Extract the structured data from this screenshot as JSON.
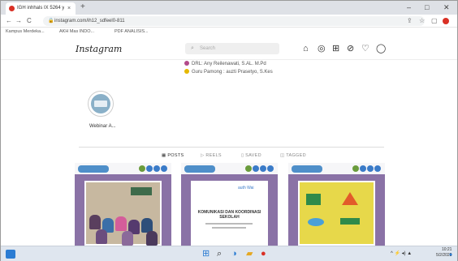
{
  "browser": {
    "tab_title": "IGH inhhals IX 5264 yemerl...",
    "tab_close": "×",
    "new_tab": "+",
    "url": "instagram.com/ih12_sdfeel0-811",
    "window_controls": [
      "–",
      "□",
      "✕"
    ],
    "nav": {
      "back": "←",
      "forward": "→",
      "reload": "C"
    },
    "toolbar_icons": [
      "share-icon",
      "star-icon",
      "extensions-icon"
    ],
    "bookmarks": [
      "Kampus Merdeka...",
      "AKH Mas INDO...",
      "PDF ANALISIS..."
    ]
  },
  "instagram": {
    "logo": "Instagram",
    "search_placeholder": "Search",
    "nav_icons": [
      "home-icon",
      "messenger-icon",
      "new-post-icon",
      "explore-icon",
      "heart-icon",
      "profile-icon"
    ],
    "bio": [
      "DRL: Any Reilenawati, S.AL. M.Pd",
      "Guru Pamong : auzti Prasetyo, S.Kes"
    ],
    "highlight_label": "Webinar A...",
    "tabs": [
      "POSTS",
      "REELS",
      "SAVED",
      "TAGGED"
    ],
    "posts": [
      {
        "kind": "classroom-photo"
      },
      {
        "kind": "document",
        "brand": "auth Wai",
        "title": "KOMUNIKASI DAN KOORDINASI SEKOLAH"
      },
      {
        "kind": "yellow-shapes"
      }
    ]
  },
  "taskbar": {
    "tray_text": "^ ⚡ ◂) ▲",
    "time": "10:21",
    "date": "5/2/2022"
  },
  "colors": {
    "post_bg": "#8a72a6",
    "accent_blue": "#2b7cd3",
    "yellow": "#e7d84a"
  }
}
